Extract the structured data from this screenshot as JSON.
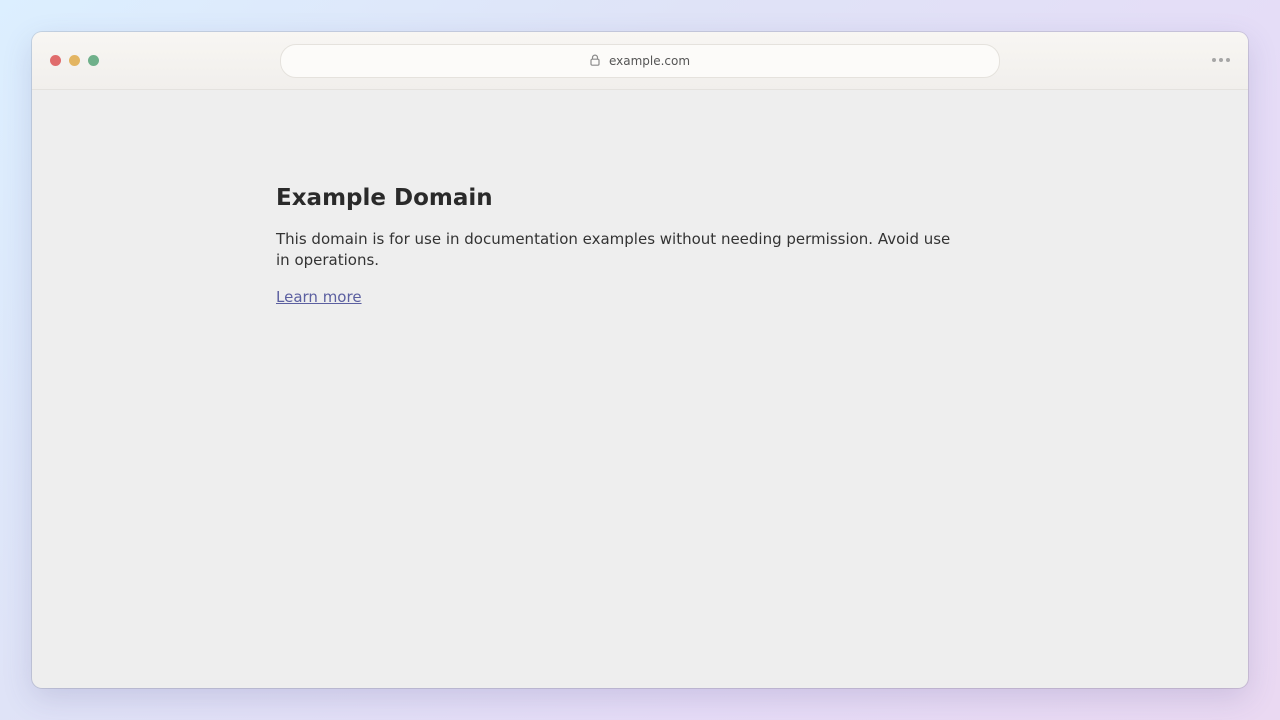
{
  "browser": {
    "url": "example.com",
    "icons": {
      "lock": "lock-icon",
      "menu": "more-horizontal-icon"
    },
    "traffic_lights": {
      "close": "#e06c6c",
      "minimize": "#e3b562",
      "maximize": "#6fb08a"
    }
  },
  "page": {
    "title": "Example Domain",
    "description": "This domain is for use in documentation examples without needing permission. Avoid use in operations.",
    "link_label": "Learn more",
    "colors": {
      "background": "#eeeeee",
      "link": "#5b5fa0"
    }
  }
}
